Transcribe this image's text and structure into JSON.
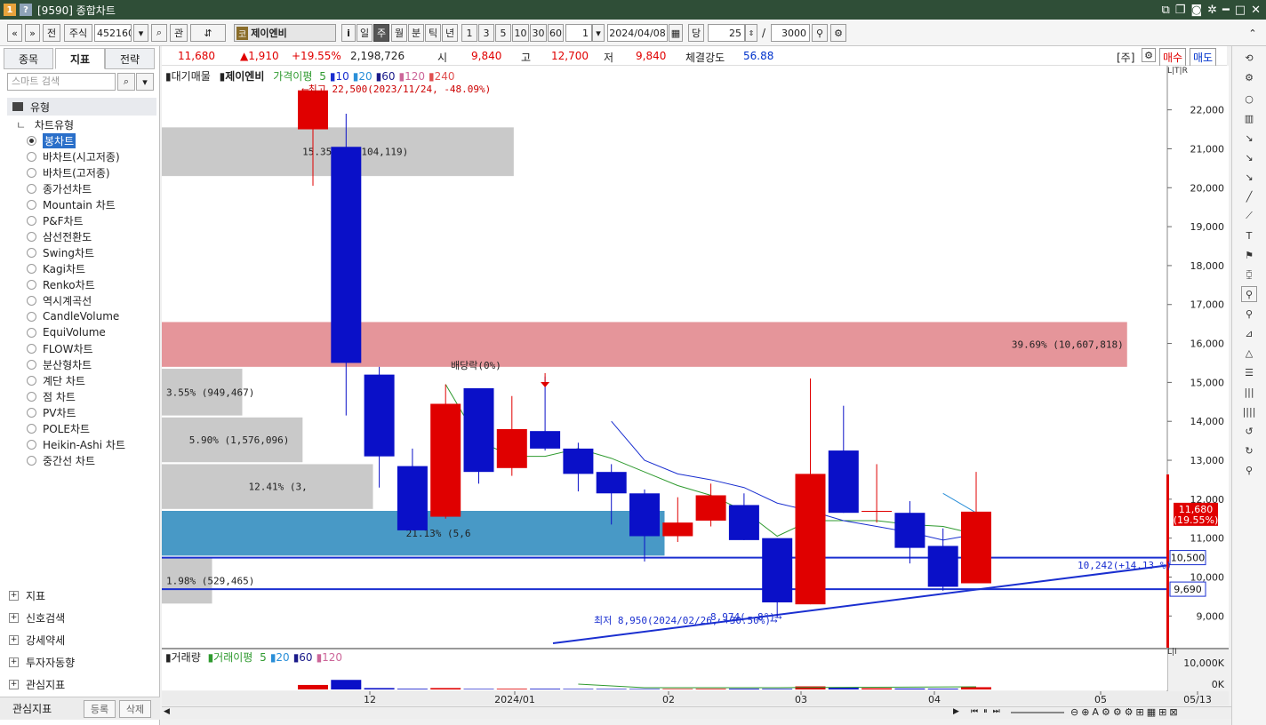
{
  "window": {
    "badge1": "1",
    "badge2": "?",
    "title": "[9590] 종합차트"
  },
  "toolbar": {
    "back": "«",
    "fwd": "»",
    "prev": "전",
    "type": "주식",
    "code": "452160",
    "dropdown": "▾",
    "search": "⌕",
    "relation": "관",
    "updown": "⇵",
    "kosdaq": "코",
    "stock_name": "제이엔비",
    "info": "i",
    "periods": [
      "일",
      "주",
      "월",
      "분",
      "틱",
      "년"
    ],
    "active_period": "주",
    "intervals": [
      "1",
      "3",
      "5",
      "10",
      "30",
      "60"
    ],
    "unit_value": "1",
    "date": "2024/04/08",
    "view_label": "당",
    "view_count": "25",
    "slash": "/",
    "total_count": "3000"
  },
  "left": {
    "tabs": [
      "종목",
      "지표",
      "전략"
    ],
    "active_tab": "지표",
    "search_placeholder": "스마트 검색",
    "root": "유형",
    "sub": "차트유형",
    "chart_types": [
      "봉차트",
      "바차트(시고저종)",
      "바차트(고저종)",
      "종가선차트",
      "Mountain 차트",
      "P&F차트",
      "삼선전환도",
      "Swing차트",
      "Kagi차트",
      "Renko차트",
      "역시계곡선",
      "CandleVolume",
      "EquiVolume",
      "FLOW차트",
      "분산형차트",
      "계단 차트",
      "점 차트",
      "PV차트",
      "POLE차트",
      "Heikin-Ashi 차트",
      "중간선 차트"
    ],
    "selected_type": "봉차트",
    "groups": [
      "지표",
      "신호검색",
      "강세약세",
      "투자자동향",
      "관심지표"
    ],
    "footer_label": "관심지표",
    "footer_register": "등록",
    "footer_delete": "삭제"
  },
  "info": {
    "price": "11,680",
    "change": "▲1,910",
    "change_pct": "+19.55%",
    "volume": "2,198,726",
    "open_label": "시",
    "open": "9,840",
    "high_label": "고",
    "high": "12,700",
    "low_label": "저",
    "low": "9,840",
    "strength_label": "체결강도",
    "strength": "56.88",
    "tag": "[주]",
    "buy": "매수",
    "sell": "매도"
  },
  "legend": {
    "overlay": "대기매물",
    "name": "제이엔비",
    "ma_label": "가격이평",
    "ma": [
      "5",
      "10",
      "20",
      "60",
      "120",
      "240"
    ]
  },
  "vol_legend": {
    "title": "거래량",
    "ma_label": "거래이평",
    "ma": [
      "5",
      "20",
      "60",
      "120"
    ]
  },
  "annotations": {
    "high": "⟵최고 22,500(2023/11/24, -48.09%)",
    "low": "최저 8,950(2024/02/26, +30.50%)⟶",
    "dividend": "배당락(0%)",
    "line1": "10,242(+14.13 %)",
    "line2": "8,974( -8°)⟶"
  },
  "price_tags": {
    "current": "11,680",
    "current_pct": "(19.55%)",
    "level1": "10,500",
    "level2": "9,690"
  },
  "chart_data": {
    "type": "candlestick",
    "y_ticks": [
      22000,
      21000,
      20000,
      19000,
      18000,
      17000,
      16000,
      15000,
      14000,
      13000,
      12000,
      11000,
      10000,
      9000
    ],
    "ylim": [
      8300,
      22950
    ],
    "x_labels": [
      "12",
      "2024/01",
      "02",
      "03",
      "04",
      "05",
      "05/13"
    ],
    "vol_ticks": [
      "10,000K",
      "0K"
    ],
    "candles": [
      {
        "o": 21500,
        "h": 22500,
        "l": 20050,
        "c": 22500
      },
      {
        "o": 21050,
        "h": 21900,
        "l": 14150,
        "c": 15500
      },
      {
        "o": 15200,
        "h": 15400,
        "l": 12300,
        "c": 13100
      },
      {
        "o": 12850,
        "h": 13300,
        "l": 11450,
        "c": 11200
      },
      {
        "o": 11550,
        "h": 14950,
        "l": 11500,
        "c": 14450
      },
      {
        "o": 14850,
        "h": 14850,
        "l": 12400,
        "c": 12700
      },
      {
        "o": 12800,
        "h": 14650,
        "l": 12600,
        "c": 13800
      },
      {
        "o": 13750,
        "h": 15150,
        "l": 13250,
        "c": 13300
      },
      {
        "o": 13300,
        "h": 13450,
        "l": 12200,
        "c": 12650
      },
      {
        "o": 12700,
        "h": 12900,
        "l": 11350,
        "c": 12150
      },
      {
        "o": 12150,
        "h": 12250,
        "l": 10400,
        "c": 11050
      },
      {
        "o": 11050,
        "h": 12050,
        "l": 10900,
        "c": 11400
      },
      {
        "o": 11450,
        "h": 12400,
        "l": 11300,
        "c": 12100
      },
      {
        "o": 11850,
        "h": 12150,
        "l": 10950,
        "c": 10950
      },
      {
        "o": 11000,
        "h": 11000,
        "l": 8950,
        "c": 9350
      },
      {
        "o": 9300,
        "h": 15100,
        "l": 9300,
        "c": 12650
      },
      {
        "o": 13250,
        "h": 14400,
        "l": 11650,
        "c": 11650
      },
      {
        "o": 11700,
        "h": 12900,
        "l": 11400,
        "c": 11700
      },
      {
        "o": 11650,
        "h": 11950,
        "l": 10350,
        "c": 10750
      },
      {
        "o": 10800,
        "h": 11250,
        "l": 9650,
        "c": 9750
      },
      {
        "o": 9840,
        "h": 12700,
        "l": 9840,
        "c": 11680
      }
    ],
    "volume": [
      1600,
      3400,
      500,
      250,
      500,
      200,
      250,
      250,
      200,
      200,
      200,
      200,
      250,
      300,
      250,
      1100,
      600,
      450,
      350,
      300,
      800
    ],
    "vol_max": 12000,
    "profile": [
      {
        "lo": 20300,
        "hi": 21550,
        "end": 0.35,
        "color": "#c9c9c9",
        "label": "15.35% (4,104,119)"
      },
      {
        "lo": 15400,
        "hi": 16550,
        "end": 0.96,
        "color": "#e5959a",
        "label": "39.69% (10,607,818)"
      },
      {
        "lo": 14150,
        "hi": 15350,
        "end": 0.08,
        "color": "#c9c9c9",
        "label": "3.55% (949,467)"
      },
      {
        "lo": 12950,
        "hi": 14100,
        "end": 0.14,
        "color": "#c9c9c9",
        "label": "5.90% (1,576,096)"
      },
      {
        "lo": 11750,
        "hi": 12900,
        "end": 0.21,
        "color": "#c9c9c9",
        "label": "12.41% (3,"
      },
      {
        "lo": 10550,
        "hi": 11700,
        "end": 0.5,
        "color": "#4899c6",
        "label": "21.13% (5,6"
      },
      {
        "lo": 9320,
        "hi": 10500,
        "end": 0.05,
        "color": "#c9c9c9",
        "label": "1.98% (529,465)"
      }
    ],
    "ma5": [
      null,
      null,
      null,
      null,
      14950,
      13500,
      13100,
      13100,
      13300,
      13050,
      12700,
      12350,
      12100,
      11700,
      11050,
      11450,
      11450,
      11450,
      11350,
      11300,
      11100
    ],
    "ma10": [
      null,
      null,
      null,
      null,
      null,
      null,
      null,
      null,
      null,
      14000,
      13000,
      12650,
      12500,
      12300,
      11900,
      11700,
      11450,
      11300,
      11150,
      10950,
      11100
    ],
    "ma20": [
      null,
      null,
      null,
      null,
      null,
      null,
      null,
      null,
      null,
      null,
      null,
      null,
      null,
      null,
      null,
      null,
      null,
      null,
      null,
      12150,
      11650
    ],
    "hlines": [
      10500,
      9690
    ]
  }
}
